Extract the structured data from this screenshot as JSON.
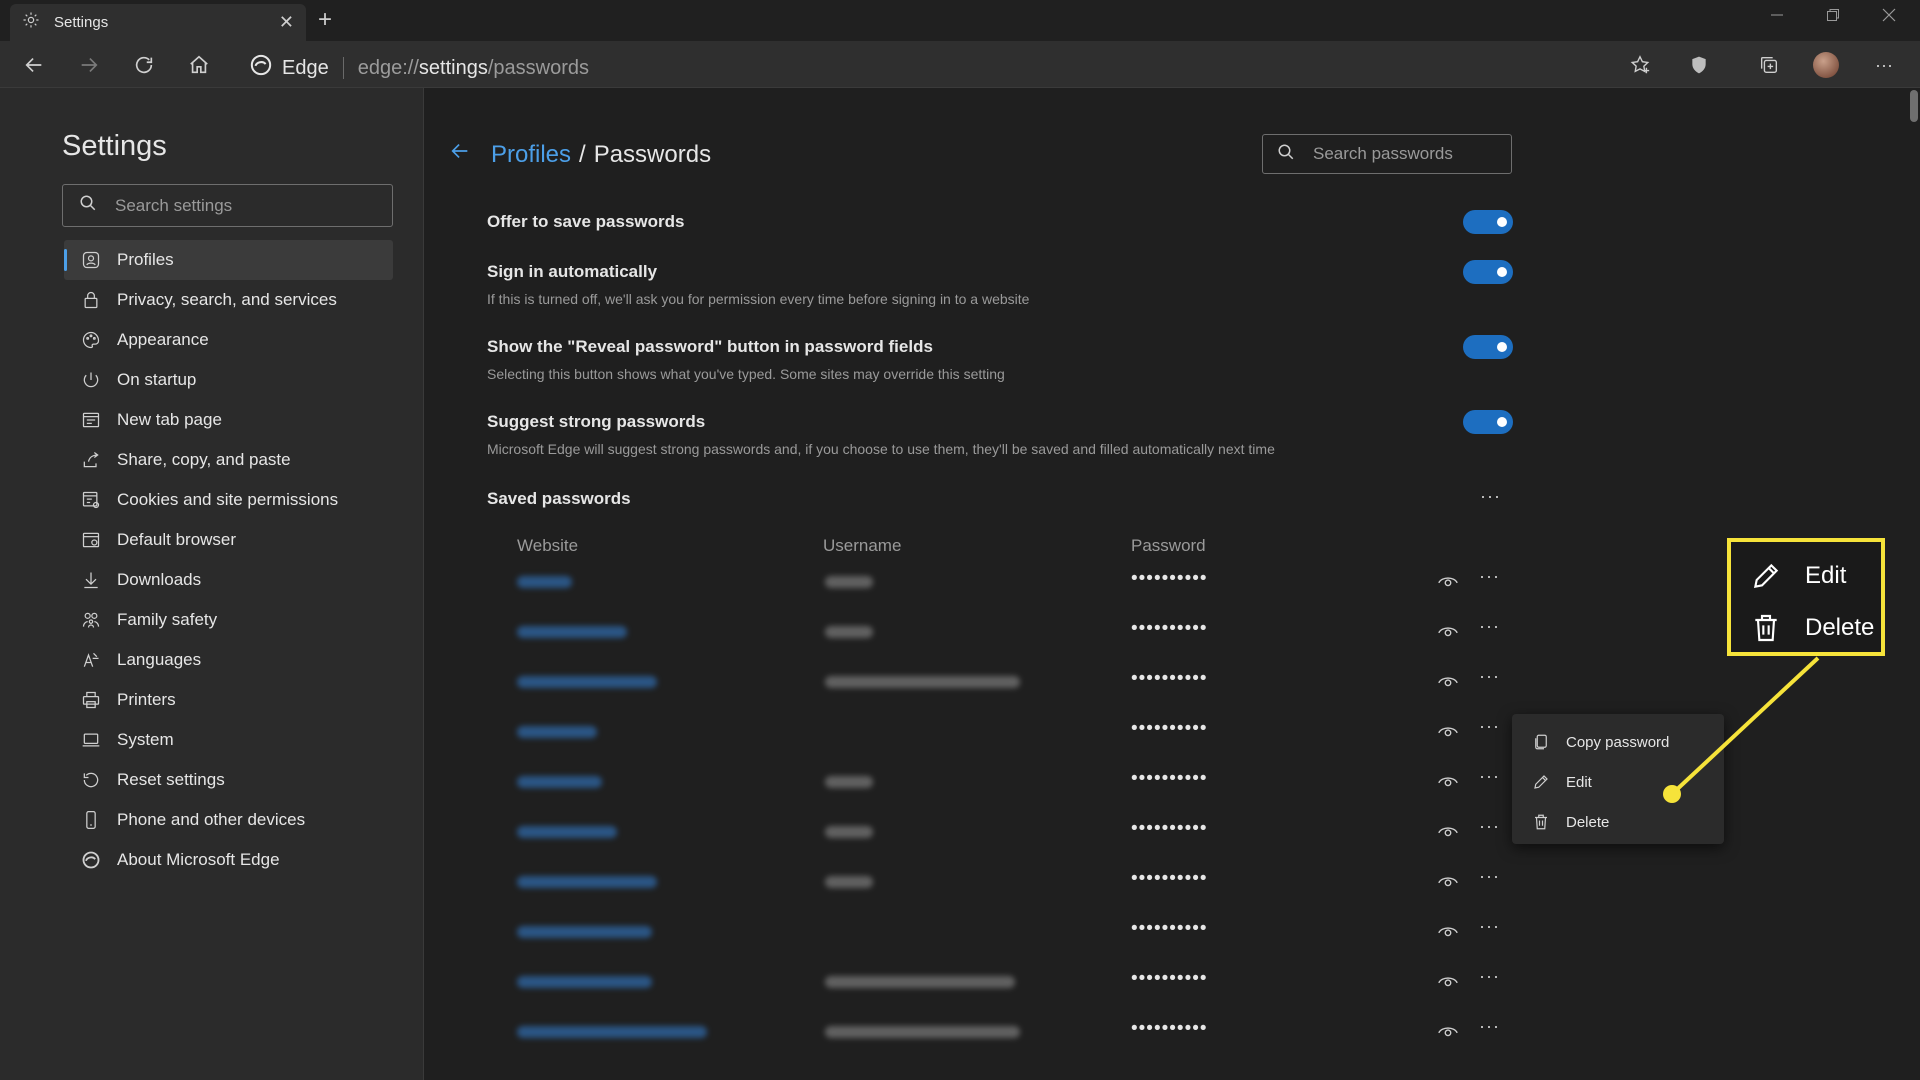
{
  "browser": {
    "tab_title": "Settings",
    "close_glyph": "✕",
    "newtab_glyph": "+",
    "address": {
      "brand": "Edge",
      "url_prefix": "edge://",
      "url_main": "settings",
      "url_suffix": "/passwords"
    }
  },
  "sidebar": {
    "title": "Settings",
    "search_placeholder": "Search settings",
    "items": [
      {
        "label": "Profiles",
        "icon": "profile-icon"
      },
      {
        "label": "Privacy, search, and services",
        "icon": "lock-icon"
      },
      {
        "label": "Appearance",
        "icon": "palette-icon"
      },
      {
        "label": "On startup",
        "icon": "power-icon"
      },
      {
        "label": "New tab page",
        "icon": "newtab-icon"
      },
      {
        "label": "Share, copy, and paste",
        "icon": "share-icon"
      },
      {
        "label": "Cookies and site permissions",
        "icon": "cookies-icon"
      },
      {
        "label": "Default browser",
        "icon": "browser-icon"
      },
      {
        "label": "Downloads",
        "icon": "download-icon"
      },
      {
        "label": "Family safety",
        "icon": "family-icon"
      },
      {
        "label": "Languages",
        "icon": "language-icon"
      },
      {
        "label": "Printers",
        "icon": "printer-icon"
      },
      {
        "label": "System",
        "icon": "system-icon"
      },
      {
        "label": "Reset settings",
        "icon": "reset-icon"
      },
      {
        "label": "Phone and other devices",
        "icon": "phone-icon"
      },
      {
        "label": "About Microsoft Edge",
        "icon": "edge-icon"
      }
    ]
  },
  "main": {
    "breadcrumb_parent": "Profiles",
    "breadcrumb_sep": "/",
    "breadcrumb_current": "Passwords",
    "search_placeholder": "Search passwords",
    "settings": [
      {
        "title": "Offer to save passwords",
        "desc": "",
        "enabled": true
      },
      {
        "title": "Sign in automatically",
        "desc": "If this is turned off, we'll ask you for permission every time before signing in to a website",
        "enabled": true
      },
      {
        "title": "Show the \"Reveal password\" button in password fields",
        "desc": "Selecting this button shows what you've typed. Some sites may override this setting",
        "enabled": true
      },
      {
        "title": "Suggest strong passwords",
        "desc": "Microsoft Edge will suggest strong passwords and, if you choose to use them, they'll be saved and filled automatically next time",
        "enabled": true
      }
    ],
    "saved_title": "Saved passwords",
    "more_glyph": "···",
    "columns": {
      "website": "Website",
      "username": "Username",
      "password": "Password"
    },
    "password_mask": "••••••••••"
  },
  "context_menu": {
    "items": [
      {
        "label": "Copy password",
        "icon": "copy-icon"
      },
      {
        "label": "Edit",
        "icon": "pencil-icon"
      },
      {
        "label": "Delete",
        "icon": "trash-icon"
      }
    ]
  },
  "callout": {
    "items": [
      {
        "label": "Edit",
        "icon": "pencil-icon"
      },
      {
        "label": "Delete",
        "icon": "trash-icon"
      }
    ],
    "color": "#f6e33a"
  },
  "colors": {
    "accent": "#4c9fe8",
    "toggle_on": "#1d6ec0",
    "highlight": "#f6e33a"
  }
}
